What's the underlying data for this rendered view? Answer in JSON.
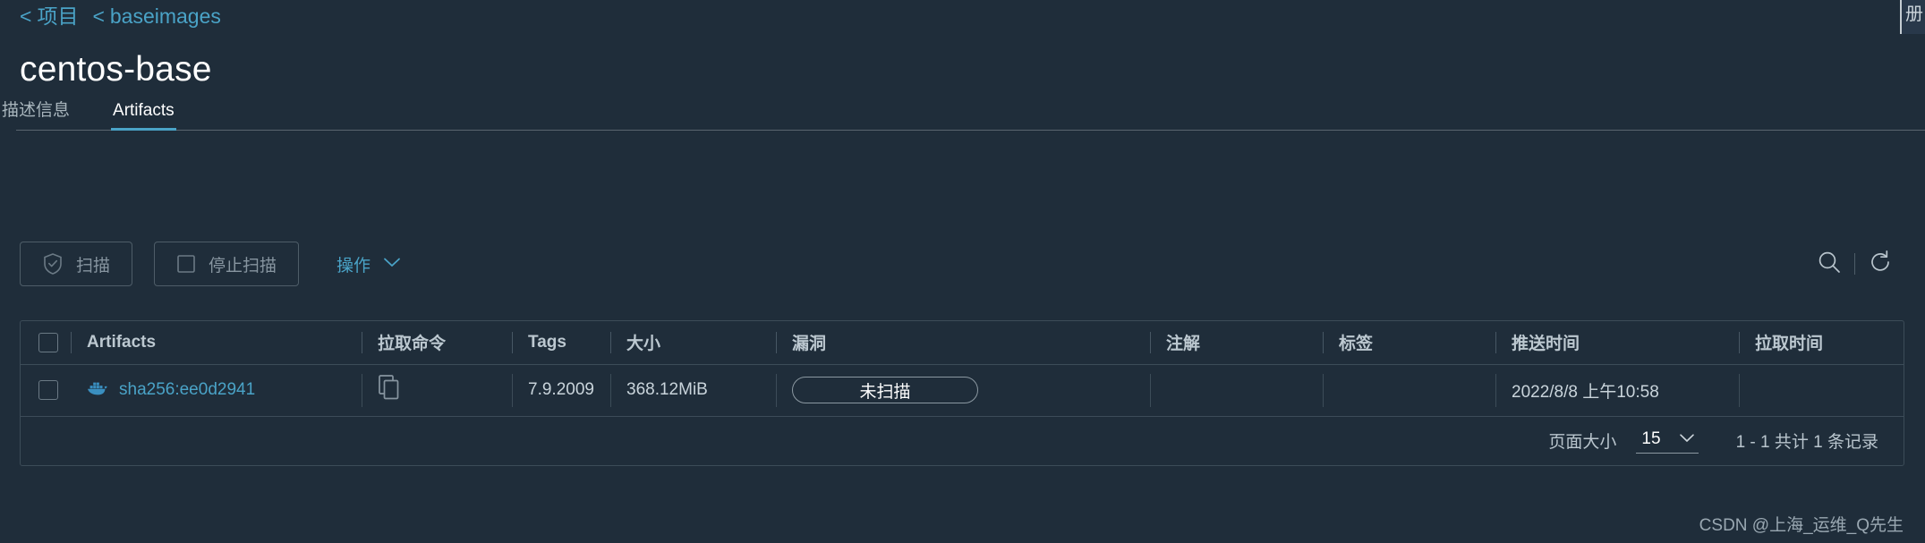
{
  "breadcrumb": {
    "items": [
      {
        "prefix": "<",
        "label": "项目"
      },
      {
        "prefix": "<",
        "label": "baseimages"
      }
    ]
  },
  "page_title": "centos-base",
  "tabs": [
    {
      "label": "描述信息",
      "active": false
    },
    {
      "label": "Artifacts",
      "active": true
    }
  ],
  "toolbar": {
    "scan_label": "扫描",
    "stop_scan_label": "停止扫描",
    "actions_label": "操作",
    "search_icon": "search-icon",
    "refresh_icon": "refresh-icon"
  },
  "table": {
    "headers": [
      "Artifacts",
      "拉取命令",
      "Tags",
      "大小",
      "漏洞",
      "注解",
      "标签",
      "推送时间",
      "拉取时间"
    ],
    "rows": [
      {
        "artifact": "sha256:ee0d2941",
        "artifact_icon": "docker-whale-icon",
        "pull_command_icon": "copy-icon",
        "tags": "7.9.2009",
        "size": "368.12MiB",
        "vulnerability": "未扫描",
        "annotation": "",
        "label": "",
        "push_time": "2022/8/8 上午10:58",
        "pull_time": ""
      }
    ]
  },
  "pagination": {
    "page_size_label": "页面大小",
    "page_size_value": "15",
    "total_label": "1 - 1 共计 1 条记录"
  },
  "watermark": "CSDN @上海_运维_Q先生",
  "edge_panel_text": "册",
  "colors": {
    "background": "#1f2d3a",
    "accent": "#4aa3c7",
    "border": "#3c4c58",
    "text_primary": "#e8eced",
    "text_muted": "#8795a0"
  }
}
